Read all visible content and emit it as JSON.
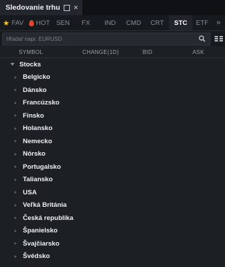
{
  "window": {
    "title": "Sledovanie trhu"
  },
  "tabs": [
    {
      "label": "FAV",
      "icon": "star-icon"
    },
    {
      "label": "HOT",
      "icon": "flame-icon"
    },
    {
      "label": "SEN"
    },
    {
      "label": "FX"
    },
    {
      "label": "IND"
    },
    {
      "label": "CMD"
    },
    {
      "label": "CRT"
    },
    {
      "label": "STC",
      "active": true
    },
    {
      "label": "ETF"
    },
    {
      "label": "»"
    }
  ],
  "search": {
    "placeholder": "Hľadať napr. EURUSD"
  },
  "columns": {
    "symbol": "SYMBOL",
    "change": "CHANGE(1D)",
    "bid": "BID",
    "ask": "ASK"
  },
  "tree": {
    "group": "Stocks",
    "items": [
      "Belgicko",
      "Dánsko",
      "Francúzsko",
      "Fínsko",
      "Holansko",
      "Nemecko",
      "Nórsko",
      "Portugalsko",
      "Taliansko",
      "USA",
      "Veľká Británia",
      "Česká republika",
      "Španielsko",
      "Švajčiarsko",
      "Švédsko"
    ]
  },
  "colors": {
    "accent_star": "#f3c623",
    "accent_flame": "#e3462c",
    "background": "#1c1f24"
  }
}
